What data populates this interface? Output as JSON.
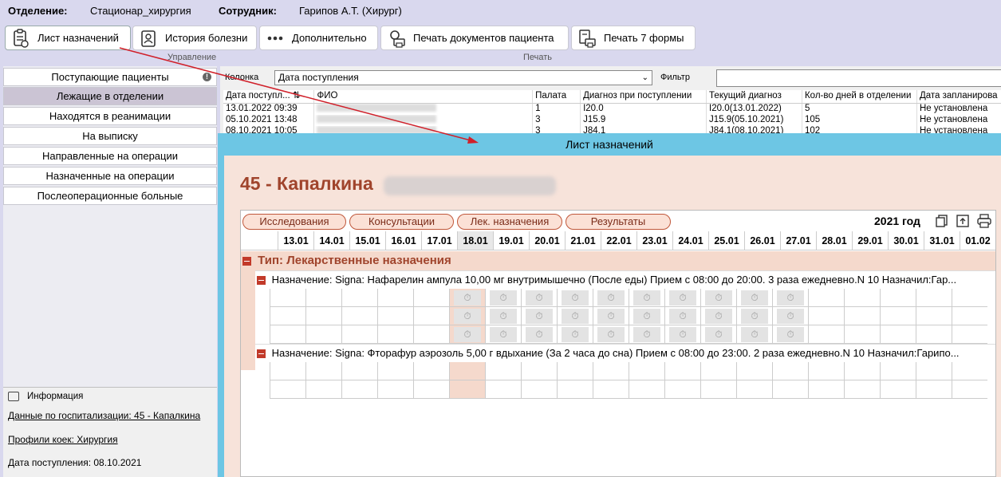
{
  "header": {
    "dept_label": "Отделение:",
    "dept_value": "Стационар_хирургия",
    "staff_label": "Сотрудник:",
    "staff_value": "Гарипов А.Т. (Хирург)"
  },
  "toolbar": {
    "buttons": [
      {
        "label": "Лист назначений",
        "icon": "clipboard-list-icon"
      },
      {
        "label": "История болезни",
        "icon": "id-badge-icon"
      },
      {
        "label": "Дополнительно",
        "icon": "more-dots-icon"
      },
      {
        "label": "Печать документов пациента",
        "icon": "print-documents-icon"
      },
      {
        "label": "Печать 7 формы",
        "icon": "print-form-icon"
      }
    ],
    "group_management": "Управление",
    "group_print": "Печать"
  },
  "sidebar": {
    "items": [
      {
        "label": "Поступающие пациенты"
      },
      {
        "label": "Лежащие в отделении"
      },
      {
        "label": "Находятся в реанимации"
      },
      {
        "label": "На выписку"
      },
      {
        "label": "Направленные на операции"
      },
      {
        "label": "Назначенные на операции"
      },
      {
        "label": "Послеоперационные больные"
      }
    ]
  },
  "info": {
    "title": "Информация",
    "hospitalization": "Данные по госпитализации: 45 - Капалкина",
    "bed_profile": "Профили коек: Хирургия",
    "admission_date": "Дата поступления: 08.10.2021"
  },
  "filter": {
    "column_label": "Колонка",
    "column_value": "Дата поступления",
    "filter_label": "Фильтр",
    "filter_value": ""
  },
  "table": {
    "headers": [
      "Дата поступл...",
      "ФИО",
      "Палата",
      "Диагноз при поступлении",
      "Текущий диагноз",
      "Кол-во дней в отделении",
      "Дата запланирова"
    ],
    "rows": [
      [
        "13.01.2022 09:39",
        "",
        "1",
        "I20.0",
        "I20.0(13.01.2022)",
        "5",
        "Не установлена"
      ],
      [
        "05.10.2021 13:48",
        "",
        "3",
        "J15.9",
        "J15.9(05.10.2021)",
        "105",
        "Не установлена"
      ],
      [
        "08.10.2021 10:05",
        "",
        "3",
        "J84.1",
        "J84.1(08.10.2021)",
        "102",
        "Не установлена"
      ]
    ]
  },
  "modal": {
    "title": "Лист назначений",
    "patient": "45 - Капалкина",
    "tabs": [
      "Исследования",
      "Консультации",
      "Лек. назначения",
      "Результаты"
    ],
    "year": "2021 год",
    "dates": [
      "13.01",
      "14.01",
      "15.01",
      "16.01",
      "17.01",
      "18.01",
      "19.01",
      "20.01",
      "21.01",
      "22.01",
      "23.01",
      "24.01",
      "25.01",
      "26.01",
      "27.01",
      "28.01",
      "29.01",
      "30.01",
      "31.01",
      "01.02"
    ],
    "today_index": 5,
    "type_label": "Тип: Лекарственные назначения",
    "prescriptions": [
      {
        "text": "Назначение: Signa: Нафарелин ампула 10,00 мг  внутримышечно (После еды)    Прием с 08:00 до 20:00. 3 раза ежедневно.N 10 Назначил:Гар...",
        "rows": 3,
        "scheduled_from": 5,
        "scheduled_to": 14
      },
      {
        "text": "Назначение: Signa: Фторафур аэрозоль 5,00 г  вдыхание (За 2 часа до сна)    Прием с 08:00 до 23:00. 2 раза ежедневно.N 10 Назначил:Гарипо...",
        "rows": 2,
        "scheduled_from": -1,
        "scheduled_to": -1
      }
    ]
  },
  "colors": {
    "accent": "#6dc6e4",
    "brand_red": "#a0442c",
    "arrow": "#d0202a"
  }
}
